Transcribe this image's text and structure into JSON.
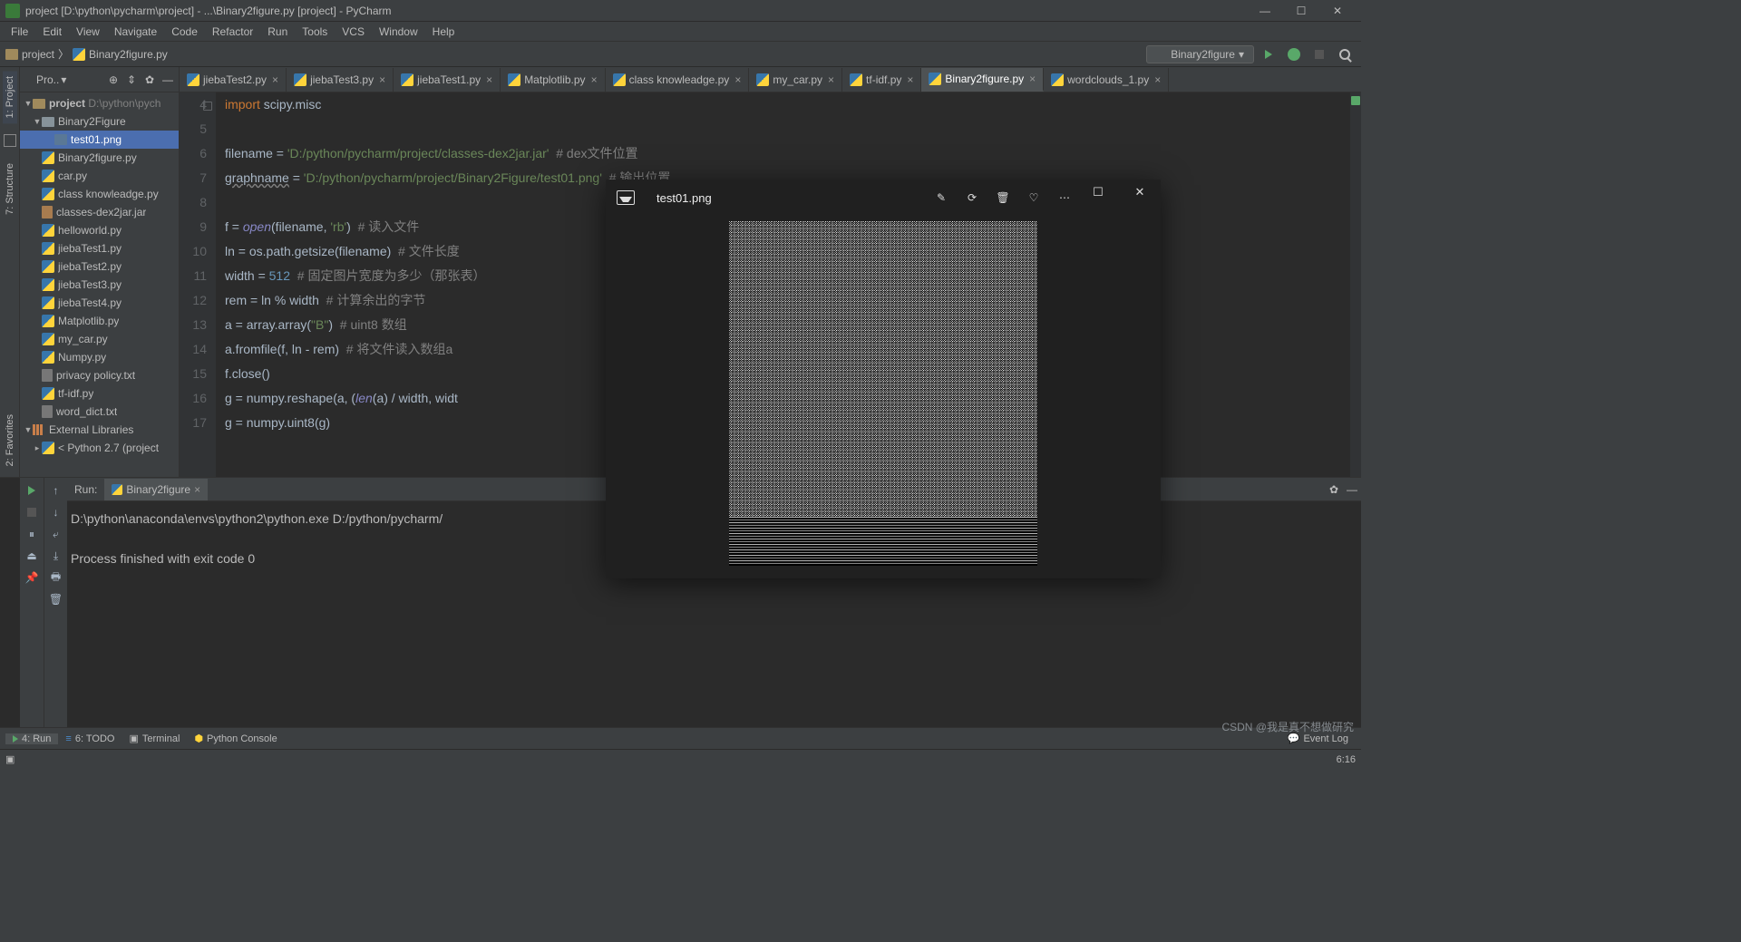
{
  "window": {
    "title": "project [D:\\python\\pycharm\\project] - ...\\Binary2figure.py [project] - PyCharm",
    "minimize": "—",
    "maximize": "☐",
    "close": "✕"
  },
  "menu": [
    "File",
    "Edit",
    "View",
    "Navigate",
    "Code",
    "Refactor",
    "Run",
    "Tools",
    "VCS",
    "Window",
    "Help"
  ],
  "breadcrumb": {
    "project": "project",
    "file": "Binary2figure.py",
    "sep": "〉"
  },
  "run_config": {
    "name": "Binary2figure",
    "chev": "▾"
  },
  "sidebar_left": {
    "project": "1: Project",
    "structure": "7: Structure",
    "favorites": "2: Favorites"
  },
  "project_tool": {
    "dropdown": "Pro..",
    "chev": "▾",
    "icons": {
      "target": "⊕",
      "collapse": "⇕",
      "gear": "✿",
      "hide": "—"
    }
  },
  "tree": {
    "root": {
      "name": "project",
      "path": "D:\\python\\pych"
    },
    "folder": "Binary2Figure",
    "selected": "test01.png",
    "files": [
      "Binary2figure.py",
      "car.py",
      "class knowleadge.py",
      "classes-dex2jar.jar",
      "helloworld.py",
      "jiebaTest1.py",
      "jiebaTest2.py",
      "jiebaTest3.py",
      "jiebaTest4.py",
      "Matplotlib.py",
      "my_car.py",
      "Numpy.py",
      "privacy policy.txt",
      "tf-idf.py",
      "word_dict.txt"
    ],
    "ext_lib": "External Libraries",
    "python": "< Python 2.7 (project"
  },
  "tabs": [
    "jiebaTest2.py",
    "jiebaTest3.py",
    "jiebaTest1.py",
    "Matplotlib.py",
    "class knowleadge.py",
    "my_car.py",
    "tf-idf.py",
    "Binary2figure.py",
    "wordclouds_1.py"
  ],
  "active_tab": 7,
  "code": {
    "line_start": 4,
    "line_end": 17,
    "l4a": "import",
    "l4b": " scipy.misc",
    "l6a": "filename = ",
    "l6b": "'D:/python/pycharm/project/classes-dex2jar.jar'",
    "l6c": "  # dex文件位置",
    "l7a": "graphname",
    "l7b": " = ",
    "l7c": "'D:/python/pycharm/project/Binary2Figure/test01.png'",
    "l7d": "  # 输出位置",
    "l9a": "f = ",
    "l9b": "open",
    "l9c": "(filename, ",
    "l9d": "'rb'",
    "l9e": ")  ",
    "l9f": "# 读入文件",
    "l10a": "ln = os.path.getsize(filename)  ",
    "l10b": "# 文件长度",
    "l11a": "width = ",
    "l11b": "512",
    "l11c": "  # 固定图片宽度为多少（那张表）",
    "l12a": "rem = ln % width  ",
    "l12b": "# 计算余出的字节",
    "l13a": "a = array.array(",
    "l13b": "\"B\"",
    "l13c": ")  ",
    "l13d": "# uint8 数组",
    "l14a": "a.fromfile(f, ln - rem)  ",
    "l14b": "# 将文件读入数组a",
    "l15": "f.close()",
    "l16a": "g = numpy.reshape(a, (",
    "l16b": "len",
    "l16c": "(a) / width, widt",
    "l17": "g = numpy.uint8(g)"
  },
  "run": {
    "label": "Run:",
    "tab": "Binary2figure",
    "out1": "D:\\python\\anaconda\\envs\\python2\\python.exe D:/python/pycharm/",
    "out2": "Process finished with exit code 0",
    "gear": "✿",
    "hide": "—"
  },
  "bottom": {
    "run": "4: Run",
    "todo": "6: TODO",
    "terminal": "Terminal",
    "pycon": "Python Console",
    "event": "Event Log"
  },
  "status": {
    "pos": "6:16",
    "watermark": "CSDN @我是真不想做研究"
  },
  "viewer": {
    "filename": "test01.png",
    "win": {
      "max": "☐",
      "close": "✕"
    }
  }
}
